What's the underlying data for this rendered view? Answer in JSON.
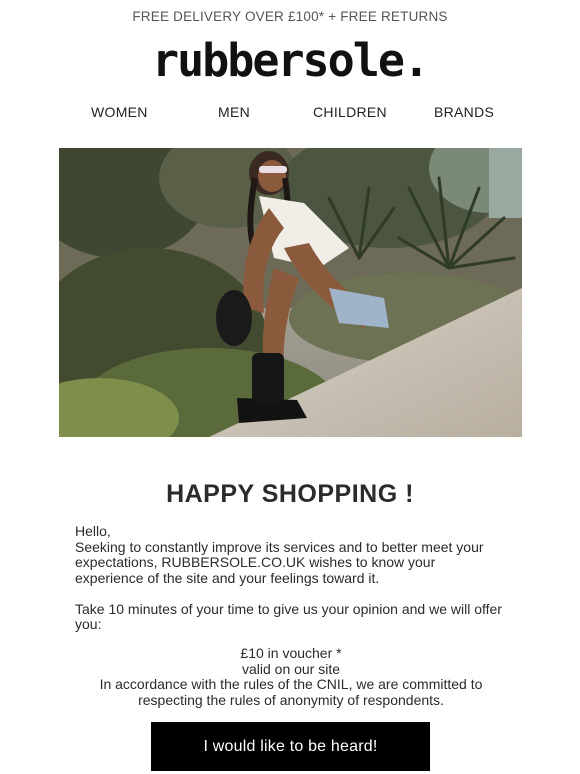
{
  "topbar": {
    "text": "FREE DELIVERY OVER £100* + FREE RETURNS"
  },
  "logo": {
    "text": "rubbersole."
  },
  "nav": {
    "items": [
      {
        "label": "WOMEN"
      },
      {
        "label": "MEN"
      },
      {
        "label": "CHILDREN"
      },
      {
        "label": "BRANDS"
      }
    ]
  },
  "main": {
    "title": "HAPPY SHOPPING !",
    "greeting": "Hello,",
    "paragraph1": "Seeking to constantly improve its services and to better meet your expectations, RUBBERSOLE.CO.UK wishes to know your experience of the site and your feelings toward it.",
    "paragraph2": "Take 10 minutes of your time to give us your opinion and we will offer you:",
    "offer_line1": "£10 in voucher *",
    "offer_line2": "valid on our site",
    "offer_line3": "In accordance with the rules of the CNIL, we are committed to respecting the rules of anonymity of respondents."
  },
  "cta": {
    "label": "I would like to be heard!"
  },
  "colors": {
    "cta_bg": "#000000",
    "text": "#2b2b2b",
    "topbar_text": "#555555"
  }
}
